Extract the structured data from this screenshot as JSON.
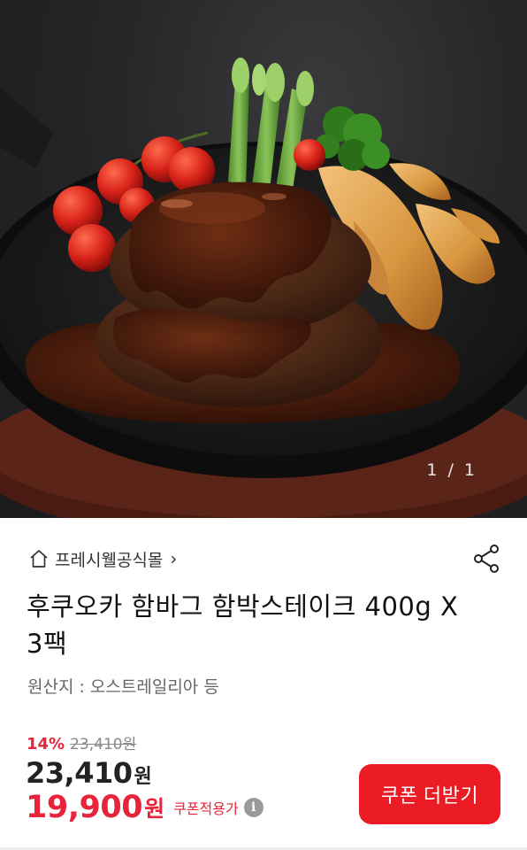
{
  "gallery": {
    "counter": "1 / 1",
    "image_description_icon": "product-photo"
  },
  "store": {
    "name": "프레시웰공식몰",
    "chevron": "›",
    "home_icon": "home-icon"
  },
  "share_icon": "share-icon",
  "product": {
    "title": "후쿠오카 함바그 함박스테이크 400g X3팩",
    "origin": "원산지 : 오스트레일리아 등"
  },
  "pricing": {
    "discount_rate": "14%",
    "original_price": "23,410원",
    "sale_price": "23,410",
    "sale_price_unit": "원",
    "coupon_price": "19,900",
    "coupon_price_unit": "원",
    "coupon_applied_label": "쿠폰적용가",
    "info_icon": "i"
  },
  "coupon_button": {
    "label": "쿠폰 더받기"
  },
  "colors": {
    "accent_red": "#ec1c24",
    "discount_red": "#e8243a"
  }
}
